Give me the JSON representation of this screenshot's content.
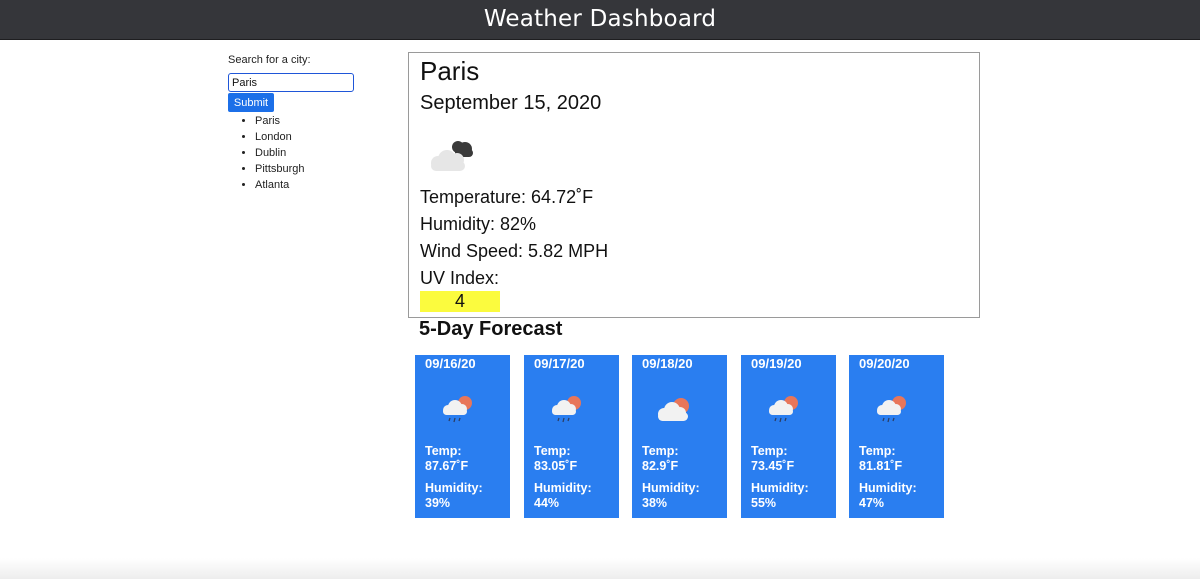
{
  "header": {
    "title": "Weather Dashboard"
  },
  "sidebar": {
    "search_label": "Search for a city:",
    "search_value": "Paris",
    "submit_label": "Submit",
    "history": [
      "Paris",
      "London",
      "Dublin",
      "Pittsburgh",
      "Atlanta"
    ]
  },
  "current": {
    "city": "Paris",
    "date": "September 15, 2020",
    "icon": "cloudy-icon",
    "temperature": "Temperature: 64.72˚F",
    "humidity": "Humidity: 82%",
    "wind": "Wind Speed: 5.82 MPH",
    "uv_label": "UV Index:",
    "uv_value": "4",
    "uv_color": "#fbfb3e"
  },
  "forecast": {
    "title": "5-Day Forecast",
    "card_color": "#2a7ef0",
    "days": [
      {
        "date": "09/16/20",
        "icon": "rain-sun-icon",
        "temp_label": "Temp:",
        "temp": "87.67˚F",
        "humidity_label": "Humidity:",
        "humidity": "39%"
      },
      {
        "date": "09/17/20",
        "icon": "rain-sun-icon",
        "temp_label": "Temp:",
        "temp": "83.05˚F",
        "humidity_label": "Humidity:",
        "humidity": "44%"
      },
      {
        "date": "09/18/20",
        "icon": "partly-cloudy-icon",
        "temp_label": "Temp:",
        "temp": "82.9˚F",
        "humidity_label": "Humidity:",
        "humidity": "38%"
      },
      {
        "date": "09/19/20",
        "icon": "rain-sun-icon",
        "temp_label": "Temp:",
        "temp": "73.45˚F",
        "humidity_label": "Humidity:",
        "humidity": "55%"
      },
      {
        "date": "09/20/20",
        "icon": "rain-sun-icon",
        "temp_label": "Temp:",
        "temp": "81.81˚F",
        "humidity_label": "Humidity:",
        "humidity": "47%"
      }
    ]
  }
}
